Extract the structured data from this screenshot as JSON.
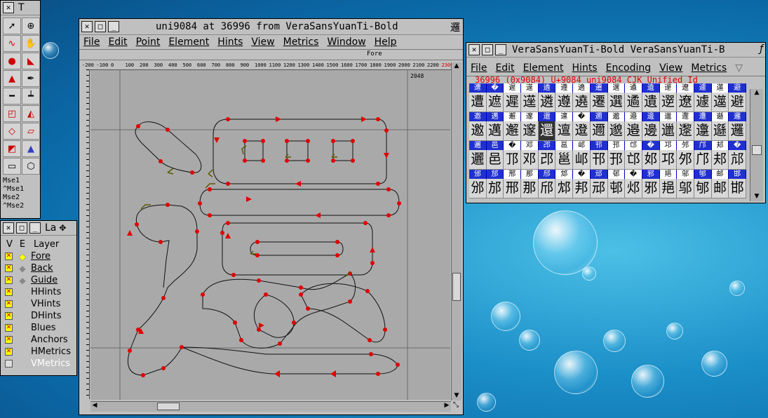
{
  "desktop": {},
  "tools_window": {
    "title": "T",
    "tools": [
      "pointer-icon",
      "magnify-icon",
      "freehand-icon",
      "hand-icon",
      "curve-point-icon",
      "corner-point-icon",
      "tangent-point-icon",
      "pen-icon",
      "knife-icon",
      "ruler-icon",
      "scale-icon",
      "flip-icon",
      "rotate-icon",
      "skew-icon",
      "perspective-icon",
      "star-icon",
      "rectangle-icon",
      "polygon-icon"
    ],
    "mouse_labels": [
      "Mse1",
      "^Mse1",
      "Mse2",
      "^Mse2"
    ]
  },
  "layers_window": {
    "title": "La",
    "header": {
      "v": "V",
      "e": "E",
      "layer": "Layer"
    },
    "layers": [
      {
        "name": "Fore",
        "checked": true,
        "editable": "yellow"
      },
      {
        "name": "Back",
        "checked": true,
        "editable": "gray"
      },
      {
        "name": "Guide",
        "checked": true,
        "editable": "gray"
      },
      {
        "name": "HHints",
        "checked": true
      },
      {
        "name": "VHints",
        "checked": true
      },
      {
        "name": "DHints",
        "checked": true
      },
      {
        "name": "Blues",
        "checked": true
      },
      {
        "name": "Anchors",
        "checked": true
      },
      {
        "name": "HMetrics",
        "checked": true
      },
      {
        "name": "VMetrics",
        "checked": false
      }
    ]
  },
  "glyph_window": {
    "title": "uni9084 at 36996 from VeraSansYuanTi-Bold",
    "menu": [
      "File",
      "Edit",
      "Point",
      "Element",
      "Hints",
      "View",
      "Metrics",
      "Window",
      "Help"
    ],
    "layer_label": "Fore",
    "ruler_labels": [
      "-200",
      "-100",
      "0",
      "100",
      "200",
      "300",
      "400",
      "500",
      "600",
      "700",
      "800",
      "900",
      "1000",
      "1100",
      "1200",
      "1300",
      "1400",
      "1500",
      "1600",
      "1700",
      "1800",
      "1900",
      "2000",
      "2100",
      "2200",
      "2300"
    ],
    "ascent_label": "2048",
    "accent_color": "#e00000"
  },
  "font_window": {
    "title": "VeraSansYuanTi-Bold  VeraSansYuanTi-B",
    "menu": [
      "File",
      "Edit",
      "Element",
      "Hints",
      "Encoding",
      "View",
      "Metrics"
    ],
    "info_line": "36996 (0x9084) U+9084  uni9084  CJK Unified Id",
    "rows": [
      {
        "labels": [
          "遭",
          "�",
          "遲",
          "遳",
          "遴",
          "遵",
          "遶",
          "遷",
          "選",
          "遹",
          "遺",
          "遻",
          "遼",
          "遽",
          "遾",
          "避"
        ],
        "glyphs": [
          "遭",
          "遮",
          "遲",
          "遳",
          "遴",
          "遵",
          "遶",
          "遷",
          "選",
          "遹",
          "遺",
          "遻",
          "遼",
          "遽",
          "遾",
          "避"
        ]
      },
      {
        "labels": [
          "邀",
          "邁",
          "邂",
          "邃",
          "還",
          "邅",
          "�",
          "邇",
          "邈",
          "邉",
          "邊",
          "邋",
          "邌",
          "邍",
          "邎",
          "邏"
        ],
        "glyphs": [
          "邀",
          "邁",
          "邂",
          "邃",
          "還",
          "邅",
          "邆",
          "邇",
          "邈",
          "邉",
          "邊",
          "邋",
          "邌",
          "邍",
          "邎",
          "邏"
        ]
      },
      {
        "labels": [
          "邐",
          "邑",
          "�",
          "邓",
          "邔",
          "邕",
          "邖",
          "邗",
          "邘",
          "邙",
          "�",
          "邛",
          "邜",
          "邝",
          "邞",
          "�"
        ],
        "glyphs": [
          "邐",
          "邑",
          "邒",
          "邓",
          "邔",
          "邕",
          "邖",
          "邗",
          "邘",
          "邙",
          "邚",
          "邛",
          "邜",
          "邝",
          "邞",
          "邟"
        ]
      },
      {
        "labels": [
          "邠",
          "邡",
          "邢",
          "那",
          "邤",
          "邥",
          "�",
          "邧",
          "邨",
          "�",
          "邪",
          "邫",
          "邬",
          "邭",
          "邮",
          "邯"
        ],
        "glyphs": [
          "邠",
          "邡",
          "邢",
          "那",
          "邤",
          "邥",
          "邦",
          "邧",
          "邨",
          "邩",
          "邪",
          "邫",
          "邬",
          "邭",
          "邮",
          "邯"
        ]
      }
    ],
    "selected": {
      "row": 1,
      "col": 4
    }
  }
}
